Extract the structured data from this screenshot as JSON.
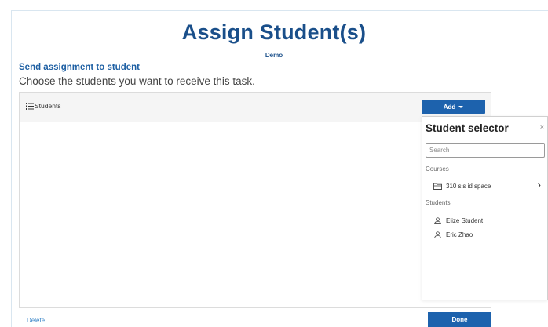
{
  "page": {
    "title": "Assign Student(s)",
    "subtitle": "Demo"
  },
  "section": {
    "heading": "Send assignment to student",
    "description": "Choose the students you want to receive this task."
  },
  "panel": {
    "header_label": "Students",
    "header_icon": "list-icon",
    "add_button": "Add"
  },
  "selector": {
    "title": "Student selector",
    "close": "×",
    "search_placeholder": "Search",
    "courses_label": "Courses",
    "courses": [
      {
        "label": "310 sis id space",
        "icon": "folder-icon",
        "arrow": "›"
      }
    ],
    "students_label": "Students",
    "students": [
      {
        "label": "Elize Student",
        "icon": "user-icon"
      },
      {
        "label": "Eric Zhao",
        "icon": "user-icon"
      }
    ]
  },
  "footer": {
    "delete_label": "Delete",
    "done_label": "Done"
  },
  "colors": {
    "brand_blue": "#1d62ad",
    "title_blue": "#1a4f8a",
    "link_blue": "#3a86c8"
  }
}
